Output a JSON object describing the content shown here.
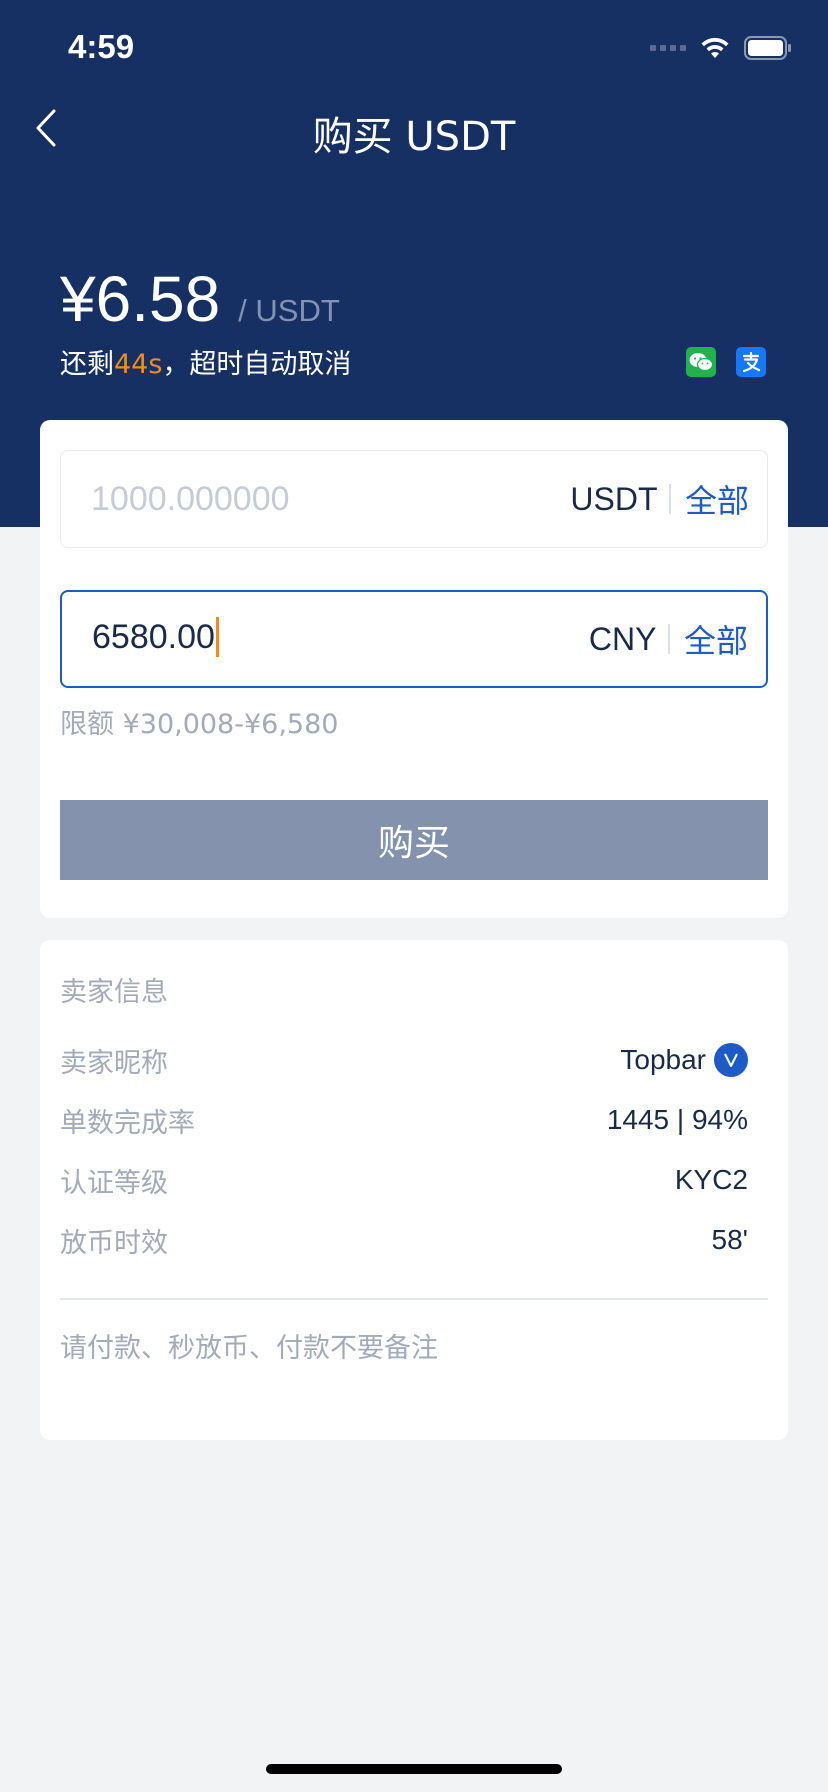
{
  "status_bar": {
    "time": "4:59"
  },
  "nav": {
    "title": "购买 USDT"
  },
  "price": {
    "value": "¥6.58",
    "unit": "/ USDT",
    "timer_prefix": "还剩",
    "timer_seconds": "44s",
    "timer_suffix": "，超时自动取消"
  },
  "payment_methods": [
    "wechat-pay-icon",
    "alipay-icon"
  ],
  "form": {
    "usdt_placeholder": "1000.000000",
    "usdt_currency": "USDT",
    "cny_value": "6580.00",
    "cny_currency": "CNY",
    "all_label": "全部",
    "limit_text": "限额 ¥30,008-¥6,580",
    "buy_label": "购买"
  },
  "seller": {
    "section_title": "卖家信息",
    "rows": [
      {
        "label": "卖家昵称",
        "value": "Topbar"
      },
      {
        "label": "单数完成率",
        "value": "1445 | 94%"
      },
      {
        "label": "认证等级",
        "value": "KYC2"
      },
      {
        "label": "放币时效",
        "value": "58'"
      }
    ],
    "remark": "请付款、秒放币、付款不要备注"
  },
  "colors": {
    "header_bg": "#173064",
    "accent": "#1f5bc7",
    "timer_highlight": "#f08a24",
    "button_disabled": "#8492ad"
  }
}
